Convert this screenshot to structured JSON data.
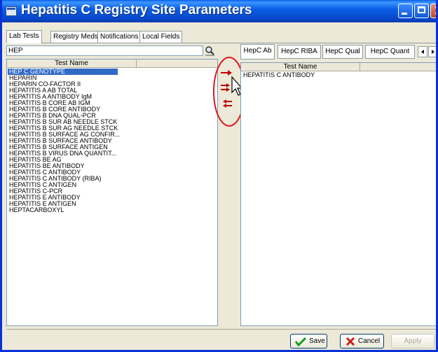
{
  "window": {
    "title": "Hepatitis C Registry Site Parameters"
  },
  "tabs": [
    {
      "label": "Lab Tests"
    },
    {
      "label": "Registry Meds"
    },
    {
      "label": "Notifications"
    },
    {
      "label": "Local Fields"
    }
  ],
  "search": {
    "value": "HEP"
  },
  "left_list": {
    "header": "Test Name",
    "selected": "HEP C GENOTYPE",
    "items": [
      "HEP C GENOTYPE",
      "HEPARIN",
      "HEPARIN CO-FACTOR II",
      "HEPATITIS A AB TOTAL",
      "HEPATITIS A ANTIBODY IgM",
      "HEPATITIS B CORE AB IGM",
      "HEPATITIS B CORE ANTIBODY",
      "HEPATITIS B DNA QUAL-PCR",
      "HEPATITIS B SUR AB NEEDLE STCK",
      "HEPATITIS B SUR AG NEEDLE STCK",
      "HEPATITIS B SURFACE AG CONFIR...",
      "HEPATITIS B SURFACE ANTIBODY",
      "HEPATITIS B SURFACE ANTIGEN",
      "HEPATITIS B VIRUS DNA QUANTIT...",
      "HEPATITIS BE AG",
      "HEPATITIS BE ANTIBODY",
      "HEPATITIS C ANTIBODY",
      "HEPATITIS C ANTIBODY (RIBA)",
      "HEPATITIS C ANTIGEN",
      "HEPATITIS C-PCR",
      "HEPATITIS E ANTIBODY",
      "HEPATITIS E ANTIGEN",
      "HEPTACARBOXYL"
    ]
  },
  "category_tabs": [
    {
      "label": "HepC Ab"
    },
    {
      "label": "HepC RIBA"
    },
    {
      "label": "HepC Qual"
    },
    {
      "label": "HepC Quant"
    }
  ],
  "right_list": {
    "header": "Test Name",
    "items": [
      "HEPATITIS C ANTIBODY"
    ]
  },
  "buttons": {
    "save": "Save",
    "cancel": "Cancel",
    "apply": "Apply"
  },
  "colors": {
    "arrow": "#c00000",
    "highlight_circle": "#e0141e",
    "selection": "#316ac5"
  }
}
